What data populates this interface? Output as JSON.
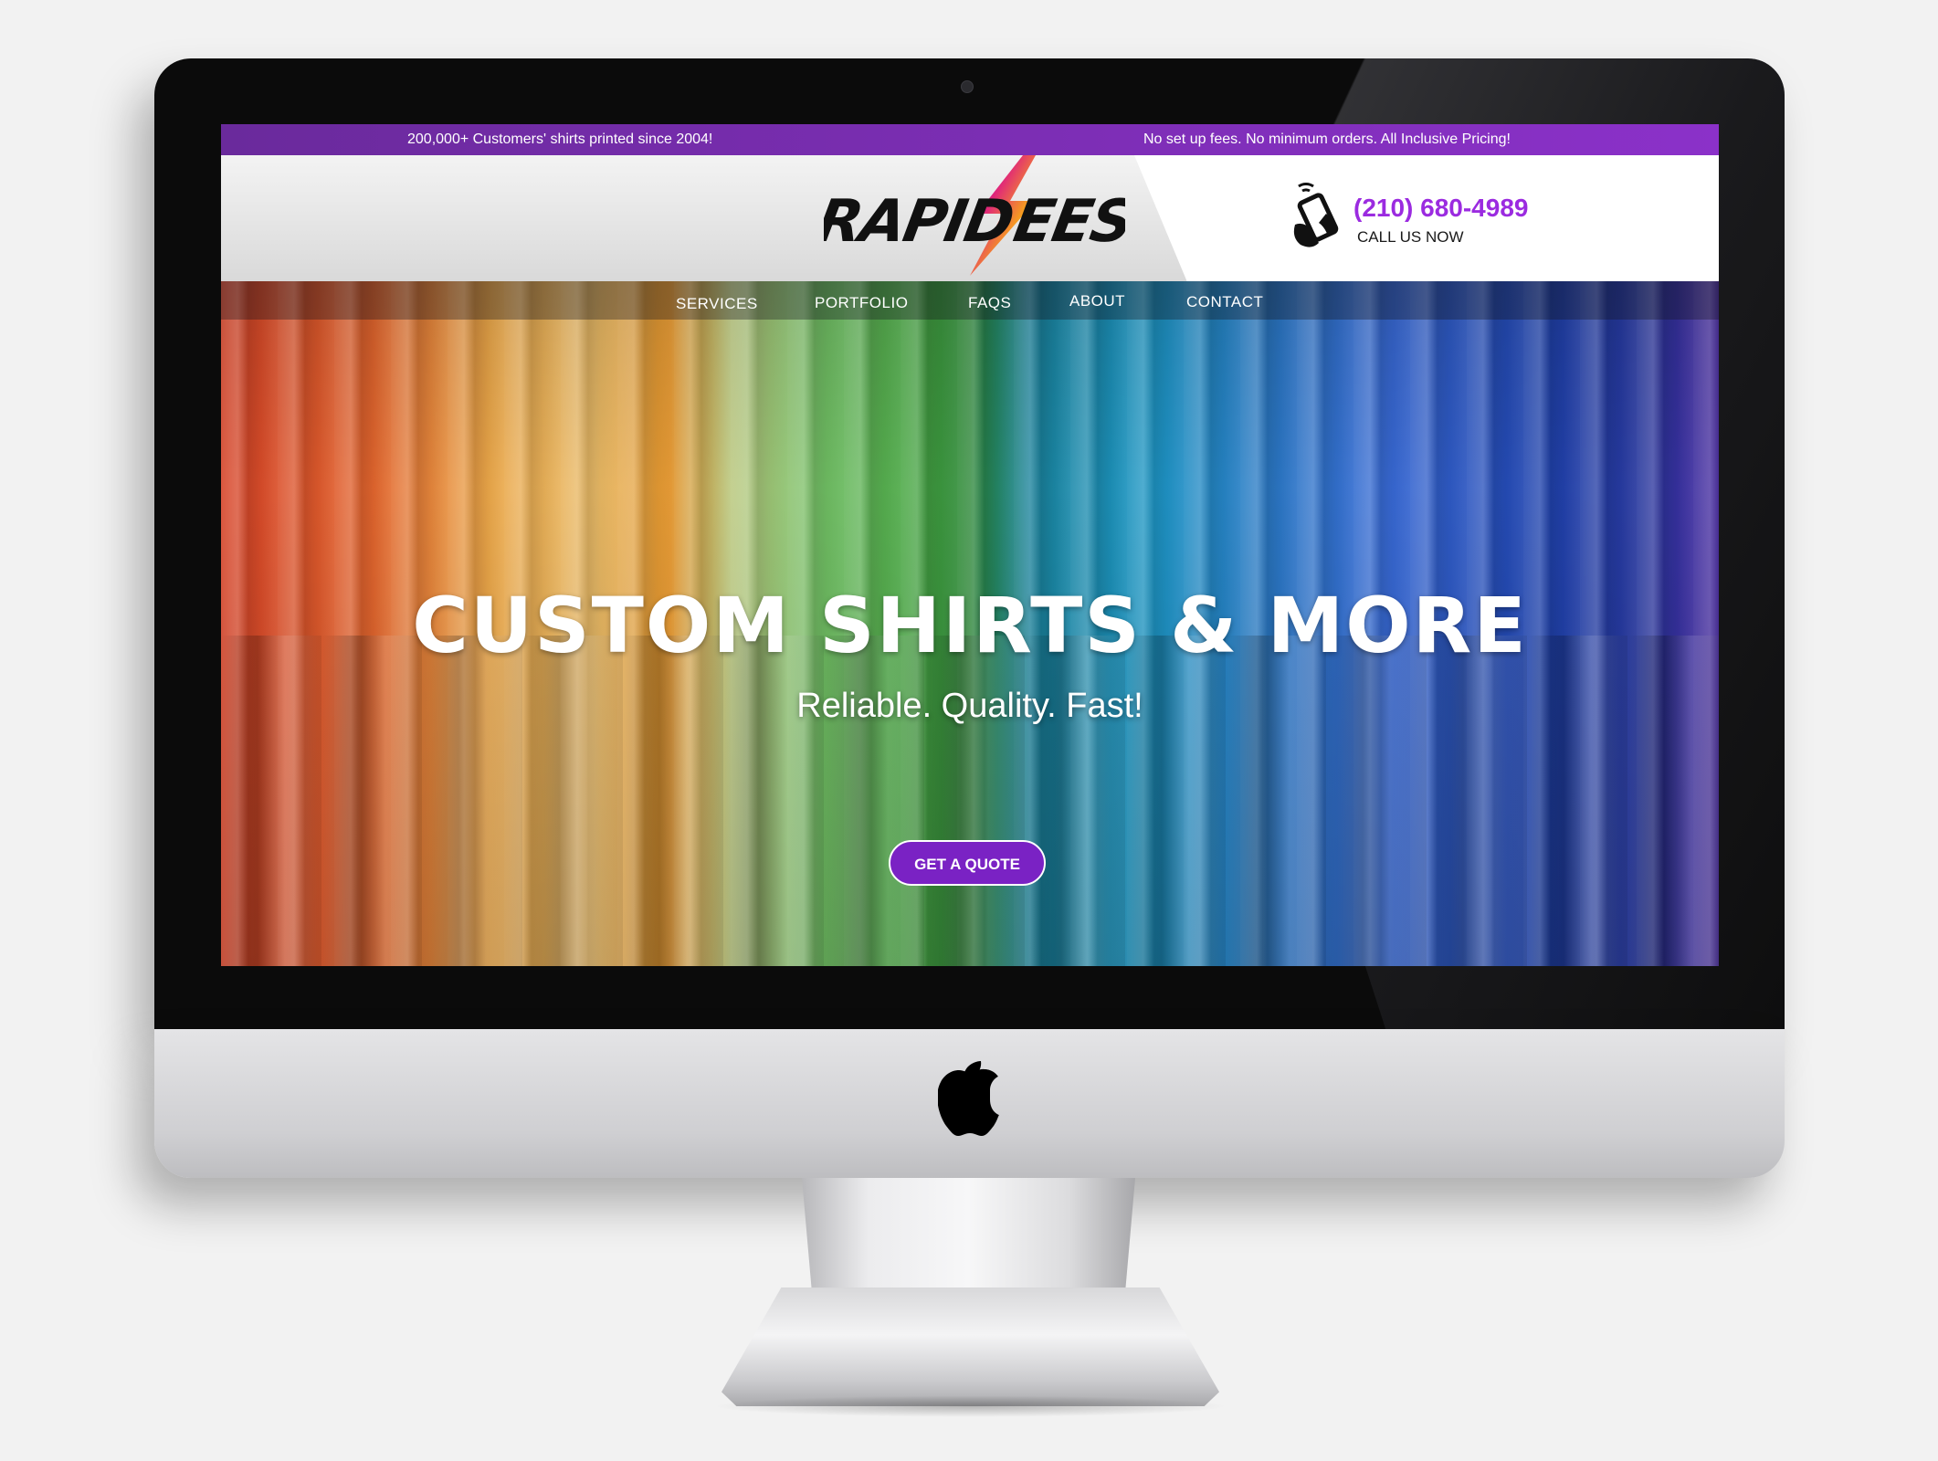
{
  "topbar": {
    "left_message": "200,000+ Customers' shirts printed since 2004!",
    "right_message": "No set up fees. No minimum orders. All Inclusive Pricing!"
  },
  "brand": {
    "logo_text": "RAPID TEES",
    "accent_color": "#9b2be0",
    "topbar_color": "#7a2db4"
  },
  "contact": {
    "phone": "(210) 680-4989",
    "cta": "CALL US NOW",
    "icon": "phone-icon"
  },
  "nav": {
    "items": [
      {
        "label": "SERVICES"
      },
      {
        "label": "PORTFOLIO"
      },
      {
        "label": "FAQS"
      },
      {
        "label": "ABOUT"
      },
      {
        "label": "CONTACT"
      }
    ]
  },
  "hero": {
    "title": "CUSTOM SHIRTS & MORE",
    "subtitle": "Reliable. Quality. Fast!",
    "button_label": "GET A QUOTE"
  },
  "device": {
    "logo_icon": "apple-logo-icon"
  }
}
